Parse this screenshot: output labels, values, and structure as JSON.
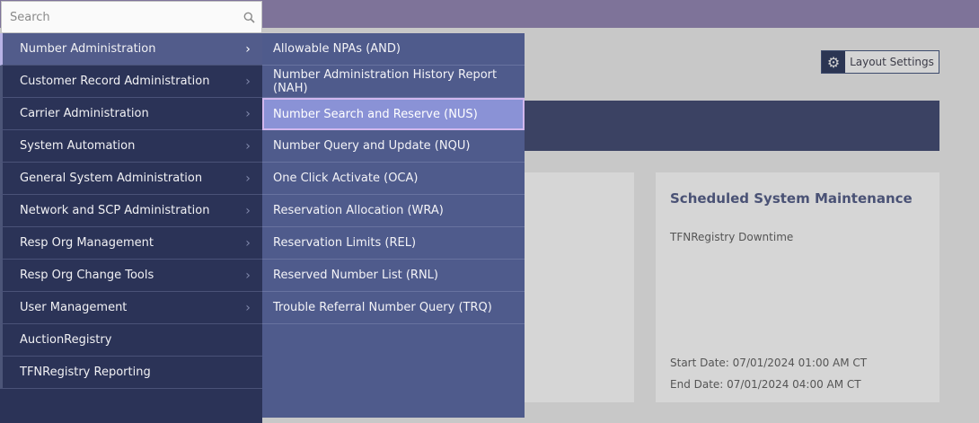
{
  "search": {
    "placeholder": "Search",
    "icon": "search-icon"
  },
  "layout_settings": {
    "label": "Layout Settings",
    "icon": "gear-icon"
  },
  "maintenance_card": {
    "title": "Scheduled System Maintenance",
    "subtitle": "TFNRegistry Downtime",
    "start": "Start Date:  07/01/2024 01:00 AM CT",
    "end": "End Date:  07/01/2024 04:00 AM CT"
  },
  "menu": {
    "items": [
      {
        "label": "Number Administration",
        "has_submenu": true
      },
      {
        "label": "Customer Record Administration",
        "has_submenu": true
      },
      {
        "label": "Carrier Administration",
        "has_submenu": true
      },
      {
        "label": "System Automation",
        "has_submenu": true
      },
      {
        "label": "General System Administration",
        "has_submenu": true
      },
      {
        "label": "Network and SCP Administration",
        "has_submenu": true
      },
      {
        "label": "Resp Org Management",
        "has_submenu": true
      },
      {
        "label": "Resp Org Change Tools",
        "has_submenu": true
      },
      {
        "label": "User Management",
        "has_submenu": true
      },
      {
        "label": "AuctionRegistry",
        "has_submenu": false
      },
      {
        "label": "TFNRegistry Reporting",
        "has_submenu": false
      }
    ]
  },
  "submenu": {
    "items": [
      {
        "label": "Allowable NPAs (AND)"
      },
      {
        "label": "Number Administration History Report (NAH)"
      },
      {
        "label": "Number Search and Reserve (NUS)"
      },
      {
        "label": "Number Query and Update (NQU)"
      },
      {
        "label": "One Click Activate (OCA)"
      },
      {
        "label": "Reservation Allocation (WRA)"
      },
      {
        "label": "Reservation Limits (REL)"
      },
      {
        "label": "Reserved Number List (RNL)"
      },
      {
        "label": "Trouble Referral Number Query (TRQ)"
      }
    ]
  },
  "colors": {
    "menu_bg": "#2b3357",
    "submenu_bg": "#4f5b8c",
    "highlight": "#8a92d6",
    "topbar": "#7e7399"
  }
}
